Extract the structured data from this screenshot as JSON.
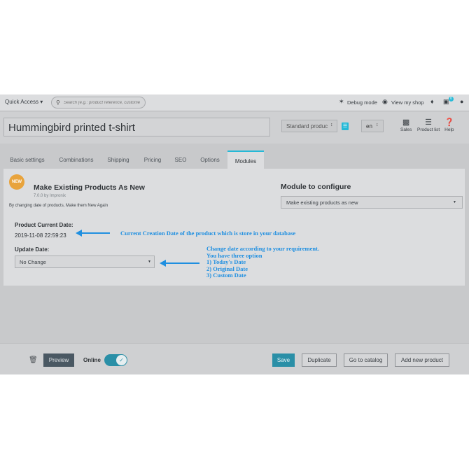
{
  "header": {
    "quick_access": "Quick Access ▾",
    "search_placeholder": "Search (e.g.: product reference, custome",
    "debug_mode": "Debug mode",
    "view_shop": "View my shop",
    "cart_badge": "0"
  },
  "product": {
    "name": "Hummingbird printed t-shirt",
    "type": "Standard produc",
    "lang": "en",
    "tools": [
      {
        "label": "Sales",
        "icon": "chart-icon"
      },
      {
        "label": "Product list",
        "icon": "list-icon"
      },
      {
        "label": "Help",
        "icon": "help-icon"
      }
    ]
  },
  "tabs": [
    "Basic settings",
    "Combinations",
    "Shipping",
    "Pricing",
    "SEO",
    "Options",
    "Modules"
  ],
  "active_tab": "Modules",
  "module": {
    "badge": "NEW",
    "title": "Make Existing Products As New",
    "version": "7.0.0 by Impronix",
    "description": "By changing date of products, Make them New Again",
    "configure_label": "Module to configure",
    "configure_value": "Make existing products as new",
    "current_date_label": "Product Current Date:",
    "current_date_value": "2019-11-08 22:59:23",
    "update_date_label": "Update Date:",
    "update_date_value": "No Change"
  },
  "annotations": {
    "current_note": "Current Creation Date of the product which is store in your database",
    "update_note": [
      "Change date according to your requirement.",
      "You have three option",
      "1) Today's Date",
      "2) Original Date",
      "3) Custom Date"
    ]
  },
  "footer": {
    "preview": "Preview",
    "online": "Online",
    "save": "Save",
    "duplicate": "Duplicate",
    "go_to_catalog": "Go to catalog",
    "add_new_product": "Add new product"
  },
  "colors": {
    "accent": "#25b9d7",
    "annotation": "#1f8fe0",
    "badge": "#e8a33c"
  }
}
